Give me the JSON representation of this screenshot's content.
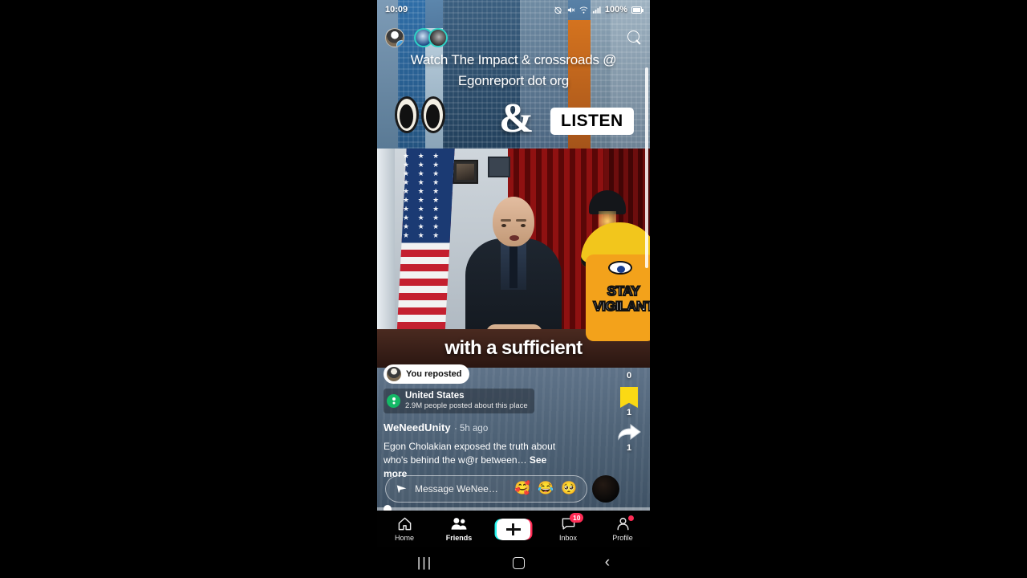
{
  "status_bar": {
    "time": "10:09",
    "battery_percent": "100%",
    "icons": [
      "alarm-off-icon",
      "mute-icon",
      "wifi-icon",
      "signal-icon",
      "battery-icon"
    ]
  },
  "top_overlay": {
    "avatar_follow_badge": "+",
    "search_icon": "search-icon"
  },
  "promo": {
    "line1": "Watch The Impact & crossroads @",
    "line2": "Egonreport dot org",
    "ampersand": "&",
    "listen_label": "LISTEN",
    "eyes_icon": "eyes-emoji"
  },
  "video": {
    "subtitle": "with a sufficient",
    "sticker_text": "STAY VIGILANT"
  },
  "repost": {
    "label": "You reposted"
  },
  "location": {
    "name": "United States",
    "subtitle": "2.9M people posted about this place"
  },
  "post": {
    "handle": "WeNeedUnity",
    "time_ago": "· 5h ago",
    "caption": "Egon Cholakian exposed the truth about who's behind the w@r between…",
    "see_more": "See more"
  },
  "message_bar": {
    "placeholder": "Message WeNee…",
    "emoji": [
      "🥰",
      "😂",
      "🥺"
    ],
    "send_icon": "send-icon"
  },
  "right_rail": {
    "comment_count": "0",
    "bookmark_count": "1",
    "share_count": "1",
    "bookmark_color": "#fbd914"
  },
  "bottom_nav": {
    "items": [
      {
        "label": "Home",
        "icon": "home-icon",
        "active": false
      },
      {
        "label": "Friends",
        "icon": "friends-icon",
        "active": true
      },
      {
        "label": "",
        "icon": "create-plus-icon",
        "active": false
      },
      {
        "label": "Inbox",
        "icon": "inbox-icon",
        "active": false,
        "badge": "10"
      },
      {
        "label": "Profile",
        "icon": "profile-icon",
        "active": false,
        "dot": true
      }
    ]
  },
  "system_nav": {
    "recents": "|||",
    "home": "home-square-icon",
    "back": "‹"
  }
}
